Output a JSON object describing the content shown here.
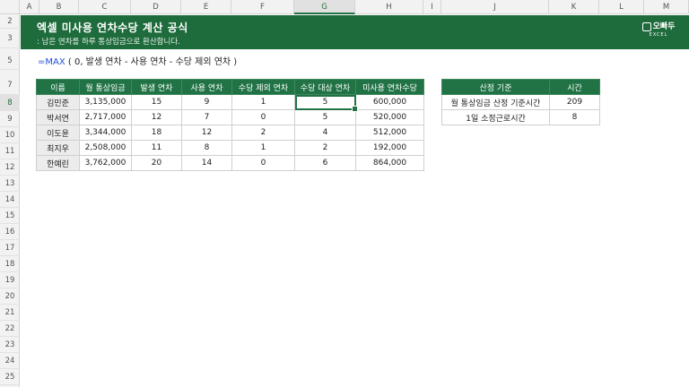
{
  "columns": [
    "A",
    "B",
    "C",
    "D",
    "E",
    "F",
    "G",
    "H",
    "I",
    "J",
    "K",
    "L",
    "M"
  ],
  "selected_column": "G",
  "rows": [
    "2",
    "3",
    "5",
    "7",
    "8",
    "9",
    "10",
    "11",
    "12",
    "13",
    "14",
    "15",
    "16",
    "17",
    "18",
    "19",
    "20",
    "21",
    "22",
    "23",
    "24",
    "25",
    "26"
  ],
  "selected_row": "8",
  "banner": {
    "title": "엑셀 미사용 연차수당 계산 공식",
    "subtitle": ": 남은 연차를 하루 통상임금으로 환산합니다.",
    "logo_text": "오빠두",
    "logo_sub": "EXCEL"
  },
  "formula": {
    "fx": "=MAX",
    "rest": " ( 0, 발생 연차 - 사용 연차 - 수당 제외 연차 )"
  },
  "main_table": {
    "headers": [
      "이름",
      "월 통상임금",
      "발생 연차",
      "사용 연차",
      "수당 제외 연차",
      "수당 대상 연차",
      "미사용 연차수당"
    ],
    "rows": [
      [
        "김민준",
        "3,135,000",
        "15",
        "9",
        "1",
        "5",
        "600,000"
      ],
      [
        "박서연",
        "2,717,000",
        "12",
        "7",
        "0",
        "5",
        "520,000"
      ],
      [
        "이도윤",
        "3,344,000",
        "18",
        "12",
        "2",
        "4",
        "512,000"
      ],
      [
        "최지우",
        "2,508,000",
        "11",
        "8",
        "1",
        "2",
        "192,000"
      ],
      [
        "한예린",
        "3,762,000",
        "20",
        "14",
        "0",
        "6",
        "864,000"
      ]
    ]
  },
  "side_table": {
    "headers": [
      "산정 기준",
      "시간"
    ],
    "rows": [
      [
        "월 통상임금 산정 기준시간",
        "209"
      ],
      [
        "1일 소정근로시간",
        "8"
      ]
    ]
  },
  "colors": {
    "brand_green": "#1e6b3c",
    "header_green": "#217346",
    "formula_blue": "#1f4fd6"
  }
}
